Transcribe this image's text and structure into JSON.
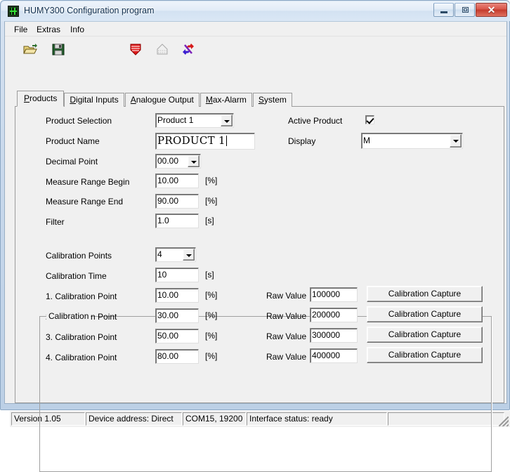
{
  "window": {
    "title": "HUMY300 Configuration program",
    "icon": "waveform-icon",
    "caption_buttons": {
      "minimize": "minimize-icon",
      "maximize": "maximize-icon",
      "close": "✕"
    }
  },
  "menubar": {
    "items": [
      {
        "label": "File"
      },
      {
        "label": "Extras"
      },
      {
        "label": "Info"
      }
    ]
  },
  "toolbar": {
    "items": [
      {
        "name": "open-file-icon",
        "title": "Open"
      },
      {
        "name": "save-file-icon",
        "title": "Save"
      },
      {
        "name": "download-to-device-icon",
        "title": "Download"
      },
      {
        "name": "upload-from-device-icon",
        "title": "Upload"
      },
      {
        "name": "transfer-icon",
        "title": "Transfer"
      }
    ]
  },
  "tabs": [
    {
      "label": "Products",
      "accel": "P",
      "rest": "roducts",
      "active": true
    },
    {
      "label": "Digital Inputs",
      "accel": "D",
      "rest": "igital Inputs",
      "active": false
    },
    {
      "label": "Analogue Output",
      "accel": "A",
      "rest": "nalogue Output",
      "active": false
    },
    {
      "label": "Max-Alarm",
      "accel": "M",
      "rest": "ax-Alarm",
      "active": false
    },
    {
      "label": "System",
      "accel": "S",
      "rest": "ystem",
      "active": false
    }
  ],
  "products_tab": {
    "product_selection": {
      "label": "Product Selection",
      "value": "Product 1"
    },
    "product_name": {
      "label": "Product Name",
      "value": "PRODUCT 1"
    },
    "decimal_point": {
      "label": "Decimal Point",
      "value": "00.00"
    },
    "measure_range_begin": {
      "label": "Measure Range Begin",
      "value": "10.00",
      "unit": "[%]"
    },
    "measure_range_end": {
      "label": "Measure Range End",
      "value": "90.00",
      "unit": "[%]"
    },
    "filter": {
      "label": "Filter",
      "value": "1.0",
      "unit": "[s]"
    },
    "active_product": {
      "label": "Active Product",
      "checked": true
    },
    "display": {
      "label": "Display",
      "value": "M"
    },
    "calibration": {
      "legend": "Calibration",
      "points": {
        "label": "Calibration Points",
        "value": "4"
      },
      "time": {
        "label": "Calibration Time",
        "value": "10",
        "unit": "[s]"
      },
      "raw_value_label": "Raw Value",
      "capture_button_label": "Calibration Capture",
      "rows": [
        {
          "label": "1. Calibration Point",
          "value": "10.00",
          "unit": "[%]",
          "raw": "100000"
        },
        {
          "label": "2. Calibration Point",
          "value": "30.00",
          "unit": "[%]",
          "raw": "200000"
        },
        {
          "label": "3. Calibration Point",
          "value": "50.00",
          "unit": "[%]",
          "raw": "300000"
        },
        {
          "label": "4. Calibration Point",
          "value": "80.00",
          "unit": "[%]",
          "raw": "400000"
        }
      ]
    }
  },
  "statusbar": {
    "version": "Version 1.05",
    "device_address": "Device address: Direct",
    "port": "COM15, 19200",
    "interface_status": "Interface status: ready",
    "spare": ""
  }
}
